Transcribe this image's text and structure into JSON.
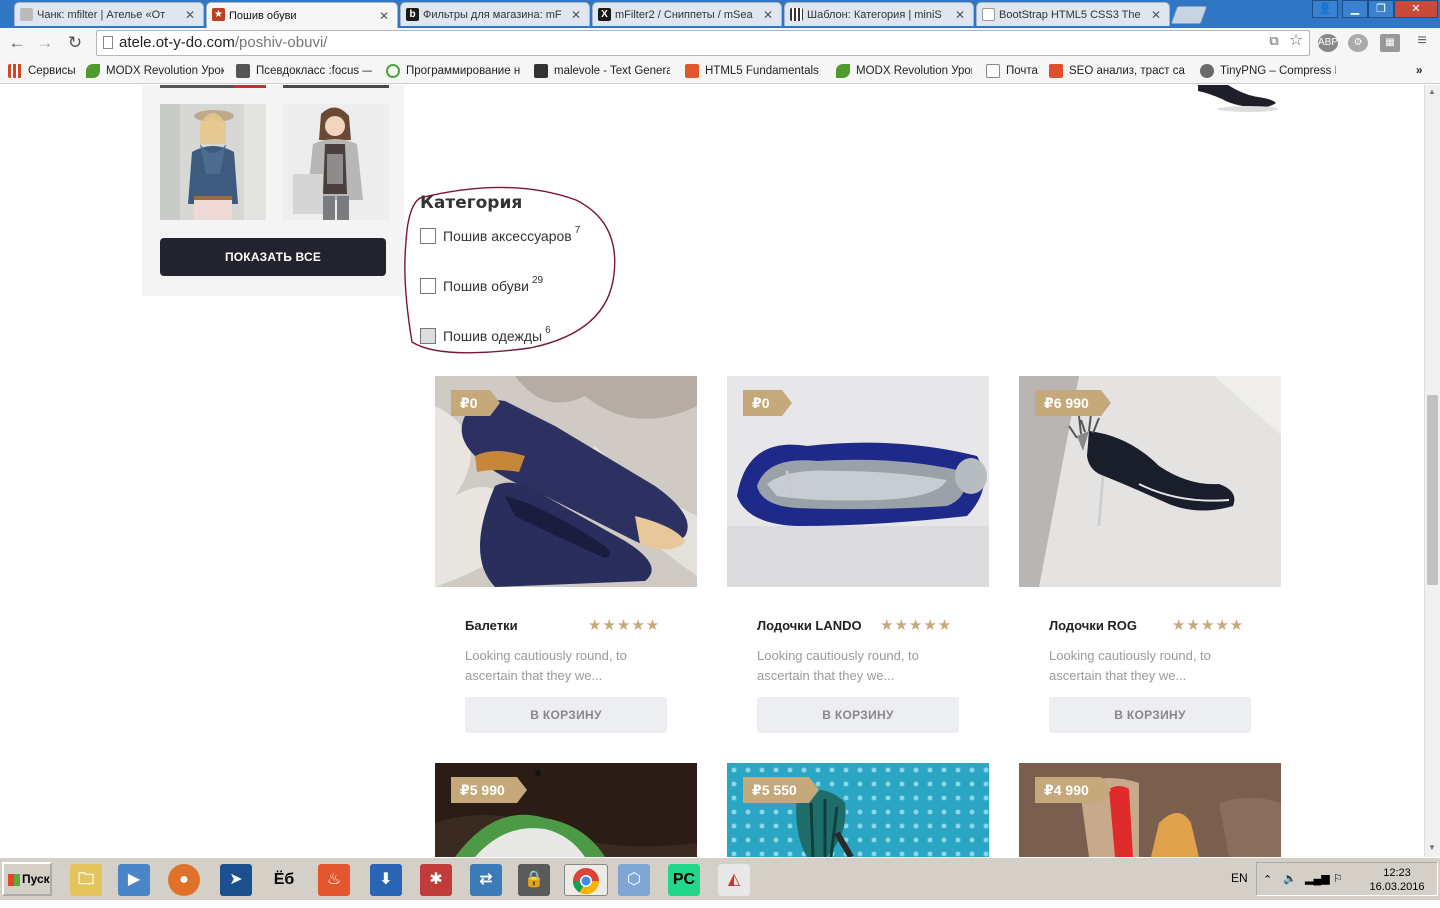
{
  "browser": {
    "tabs": [
      {
        "label": "Чанк: mfilter | Ателье «От",
        "favicon": "page-icon",
        "color": "#8a8a8a"
      },
      {
        "label": "Пошив обуви",
        "favicon": "star-icon",
        "color": "#b8421f",
        "active": true
      },
      {
        "label": "Фильтры для магазина: mF",
        "favicon": "b-icon",
        "color": "#1a1a1a"
      },
      {
        "label": "mFilter2 / Сниппеты / mSea",
        "favicon": "x-icon",
        "color": "#1a1a1a"
      },
      {
        "label": "Шаблон: Категория | miniS",
        "favicon": "bars-icon",
        "color": "#333"
      },
      {
        "label": "BootStrap HTML5 CSS3 The",
        "favicon": "page-icon",
        "color": "#8a8a8a"
      }
    ],
    "url_host": "atele.ot-y-do.com",
    "url_path": "/poshiv-obuvi/",
    "bookmarks": [
      {
        "label": "Сервисы",
        "icon_color": "#d24726"
      },
      {
        "label": "MODX Revolution Урок",
        "icon_color": "#4f9a2b"
      },
      {
        "label": "Псевдокласс :focus — (",
        "icon_color": "#555"
      },
      {
        "label": "Программирование на",
        "icon_color": "#4aa53a"
      },
      {
        "label": "malevole - Text Genera",
        "icon_color": "#333"
      },
      {
        "label": "HTML5 Fundamentals -",
        "icon_color": "#e4572e"
      },
      {
        "label": "MODX Revolution Урок",
        "icon_color": "#4f9a2b"
      },
      {
        "label": "Почта",
        "icon_color": "#888"
      },
      {
        "label": "SEO анализ, траст сай",
        "icon_color": "#e0502a"
      },
      {
        "label": "TinyPNG – Compress PN",
        "icon_color": "#6b6b6b"
      }
    ]
  },
  "sidebar": {
    "show_all_label": "ПОКАЗАТЬ ВСЕ"
  },
  "filter": {
    "title": "Категория",
    "options": [
      {
        "label": "Пошив аксессуаров",
        "count": "7"
      },
      {
        "label": "Пошив обуви",
        "count": "29"
      },
      {
        "label": "Пошив одежды",
        "count": "6"
      }
    ]
  },
  "products": [
    {
      "price": "₽0",
      "name": "Балетки",
      "desc": "Looking cautiously round, to ascertain that they we...",
      "cart": "В КОРЗИНУ",
      "rating": "★★★★★"
    },
    {
      "price": "₽0",
      "name": "Лодочки LANDO",
      "desc": "Looking cautiously round, to ascertain that they we...",
      "cart": "В КОРЗИНУ",
      "rating": "★★★★★"
    },
    {
      "price": "₽6 990",
      "name": "Лодочки ROG",
      "desc": "Looking cautiously round, to ascertain that they we...",
      "cart": "В КОРЗИНУ",
      "rating": "★★★★★"
    },
    {
      "price": "₽5 990"
    },
    {
      "price": "₽5 550"
    },
    {
      "price": "₽4 990"
    }
  ],
  "taskbar": {
    "start_label": "Пуск",
    "lang": "EN",
    "time": "12:23",
    "date": "16.03.2016"
  },
  "colors": {
    "accent_gold": "#c6a97a",
    "button_dark": "#232330",
    "circle_annotation": "#7a1535"
  }
}
